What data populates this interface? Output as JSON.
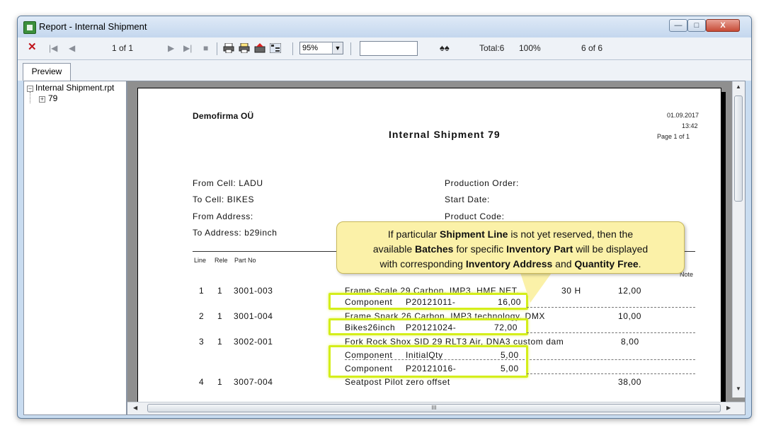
{
  "window": {
    "title": "Report - Internal Shipment",
    "min_glyph": "—",
    "max_glyph": "□",
    "close_glyph": "X"
  },
  "toolbar": {
    "page_indicator": "1 of 1",
    "zoom": "95%",
    "total": "Total:6",
    "percent": "100%",
    "count": "6 of 6"
  },
  "tabs": {
    "preview": "Preview"
  },
  "tree": {
    "root": "Internal Shipment.rpt",
    "child": "79"
  },
  "report": {
    "company": "Demofirma OÜ",
    "title": "Internal Shipment 79",
    "date": "01.09.2017",
    "time": "13:42",
    "page": "Page 1 of 1",
    "from_cell": "From Cell: LADU",
    "to_cell": "To Cell: BIKES",
    "from_address": "From Address:",
    "to_address": "To Address: b29inch",
    "production_order": "Production Order:",
    "start_date": "Start Date:",
    "product_code": "Product Code:",
    "col_line": "Line",
    "col_rele": "Rele",
    "col_part": "Part No",
    "col_note": "Note",
    "rows": [
      {
        "line": "1",
        "rel": "1",
        "part": "3001-003",
        "desc": "Frame Scale 29 Carbon, IMP3, HMF NET,",
        "desc_tail": "30 H",
        "qty": "12,00"
      },
      {
        "line": "2",
        "rel": "1",
        "part": "3001-004",
        "desc": "Frame Spark 26 Carbon, IMP3 technology, DMX",
        "qty": "10,00"
      },
      {
        "line": "3",
        "rel": "1",
        "part": "3002-001",
        "desc": "Fork Rock Shox SID 29 RLT3 Air, DNA3 custom dam",
        "qty": "8,00"
      },
      {
        "line": "4",
        "rel": "1",
        "part": "3007-004",
        "desc": "Seatpost Pilot zero offset",
        "qty": "38,00"
      }
    ],
    "batches": [
      {
        "addr": "Component",
        "batch": "P20121011-",
        "qty": "16,00"
      },
      {
        "addr": "Bikes26inch",
        "batch": "P20121024-",
        "qty": "72,00"
      },
      {
        "addr": "Component",
        "batch": "InitialQty",
        "qty": "5,00"
      },
      {
        "addr": "Component",
        "batch": "P20121016-",
        "qty": "5,00"
      }
    ]
  },
  "callout": {
    "t1": "If particular ",
    "b1": "Shipment Line",
    "t2": " is not yet reserved, then the",
    "t3": "available ",
    "b2": "Batches",
    "t4": " for specific ",
    "b3": "Inventory Part",
    "t5": " will be displayed",
    "t6": "with corresponding ",
    "b4": "Inventory Address",
    "t7": " and ",
    "b5": "Quantity Free",
    "t8": "."
  },
  "hscroll": {
    "grip": "III"
  }
}
